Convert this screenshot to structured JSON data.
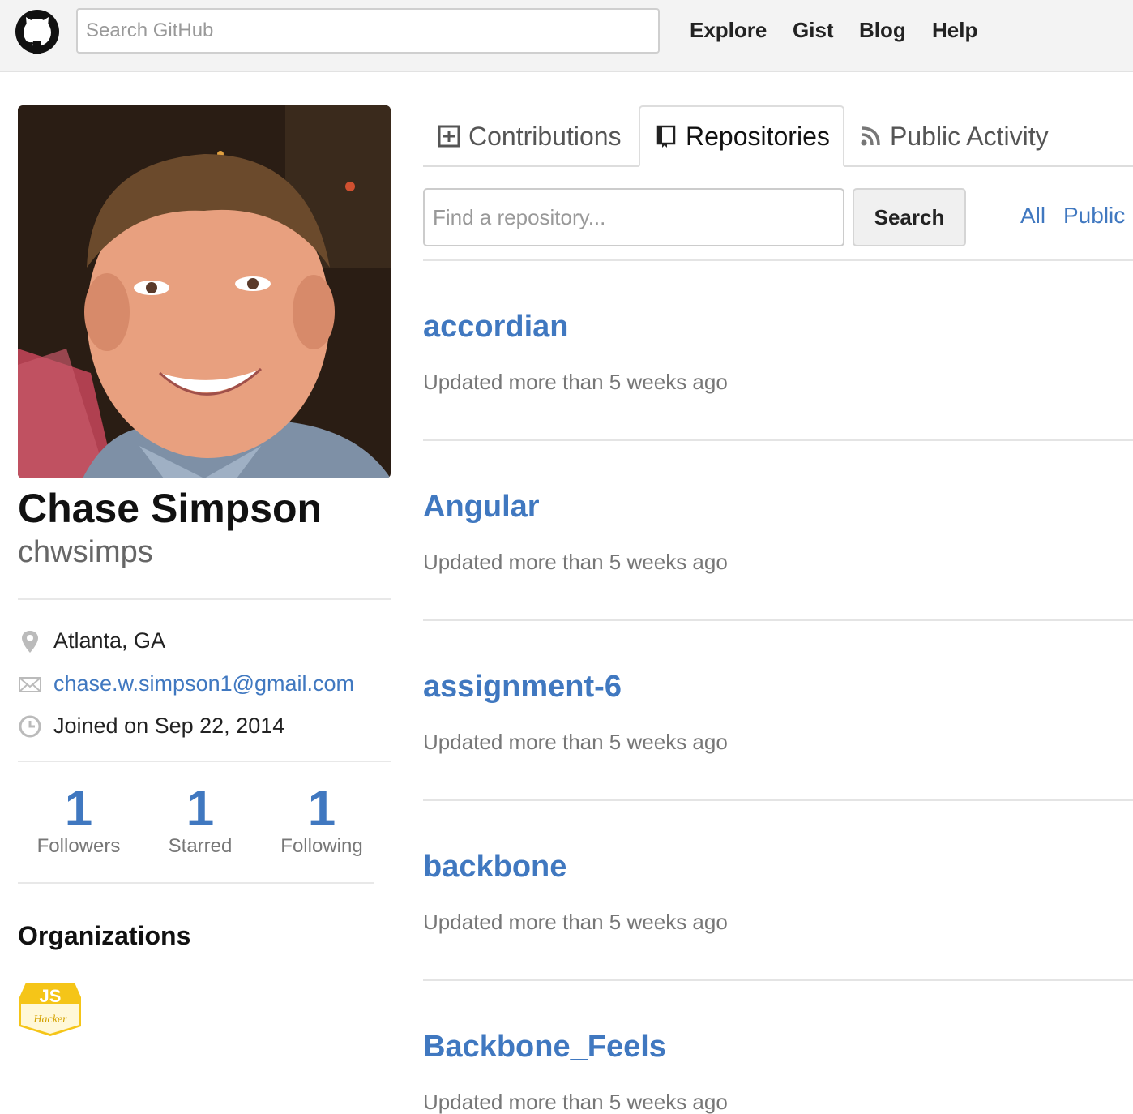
{
  "header": {
    "search_placeholder": "Search GitHub",
    "nav": {
      "explore": "Explore",
      "gist": "Gist",
      "blog": "Blog",
      "help": "Help"
    }
  },
  "profile": {
    "full_name": "Chase Simpson",
    "username": "chwsimps",
    "location": "Atlanta, GA",
    "email": "chase.w.simpson1@gmail.com",
    "joined": "Joined on Sep 22, 2014",
    "stats": [
      {
        "value": "1",
        "label": "Followers"
      },
      {
        "value": "1",
        "label": "Starred"
      },
      {
        "value": "1",
        "label": "Following"
      }
    ],
    "organizations_title": "Organizations",
    "org_badge": {
      "top_text": "JS",
      "bottom_text": "Hacker",
      "color": "#f5c518"
    }
  },
  "tabs": {
    "contributions": "Contributions",
    "repositories": "Repositories",
    "public_activity": "Public Activity"
  },
  "repo_search": {
    "placeholder": "Find a repository...",
    "button": "Search",
    "filter_all": "All",
    "filter_public": "Public"
  },
  "repos": [
    {
      "name": "accordian",
      "updated": "Updated more than 5 weeks ago"
    },
    {
      "name": "Angular",
      "updated": "Updated more than 5 weeks ago"
    },
    {
      "name": "assignment-6",
      "updated": "Updated more than 5 weeks ago"
    },
    {
      "name": "backbone",
      "updated": "Updated more than 5 weeks ago"
    },
    {
      "name": "Backbone_Feels",
      "updated": "Updated more than 5 weeks ago"
    }
  ],
  "colors": {
    "link": "#4078c0",
    "header_bg": "#f3f3f3"
  }
}
